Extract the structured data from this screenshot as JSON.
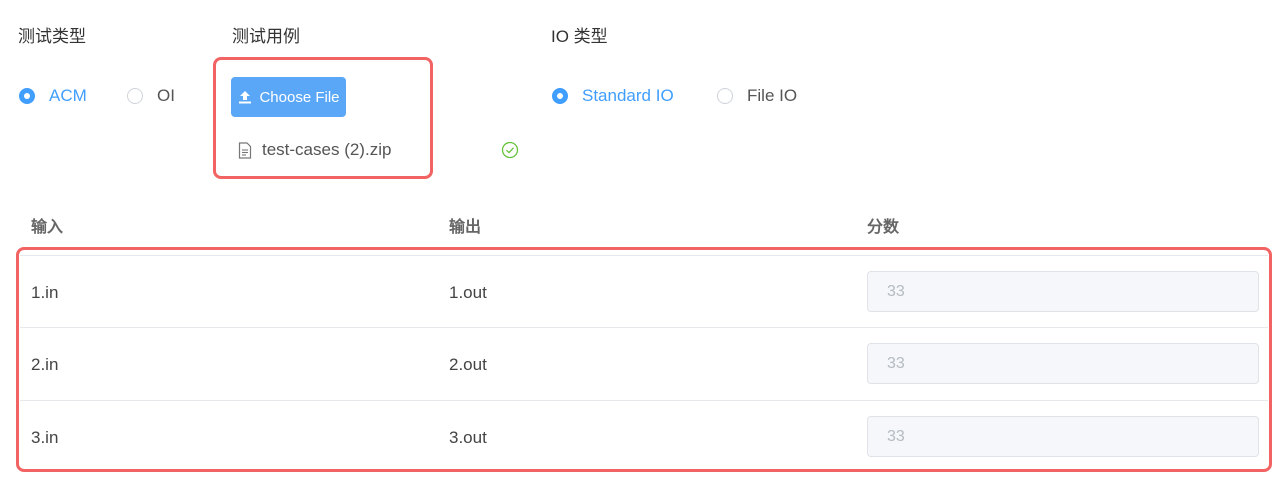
{
  "problem_type": {
    "label": "测试类型",
    "options": [
      {
        "label": "ACM",
        "checked": true
      },
      {
        "label": "OI",
        "checked": false
      }
    ]
  },
  "test_cases": {
    "label": "测试用例",
    "upload_button": "Choose File",
    "uploaded_file": "test-cases (2).zip",
    "upload_status_icon": "check-circle-icon"
  },
  "io_type": {
    "label": "IO 类型",
    "options": [
      {
        "label": "Standard IO",
        "checked": true
      },
      {
        "label": "File IO",
        "checked": false
      }
    ]
  },
  "table": {
    "headers": {
      "input": "输入",
      "output": "输出",
      "score": "分数"
    },
    "rows": [
      {
        "input": "1.in",
        "output": "1.out",
        "score": "33"
      },
      {
        "input": "2.in",
        "output": "2.out",
        "score": "33"
      },
      {
        "input": "3.in",
        "output": "3.out",
        "score": "33"
      }
    ]
  },
  "colors": {
    "accent": "#409eff",
    "button": "#5aa7f8",
    "highlight": "#f26363",
    "success": "#67c23a"
  }
}
